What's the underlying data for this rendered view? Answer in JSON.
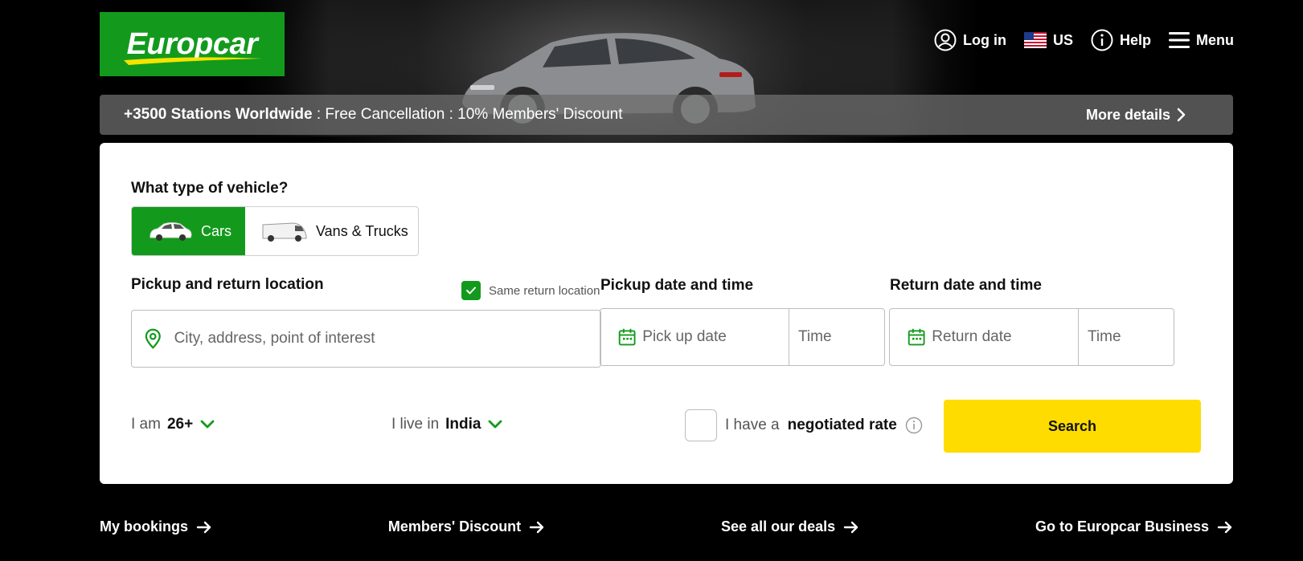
{
  "brand": {
    "name": "Europcar",
    "color": "#139a1d"
  },
  "nav": {
    "login": "Log in",
    "country": "US",
    "help": "Help",
    "menu": "Menu"
  },
  "promo": {
    "strong": "+3500 Stations Worldwide",
    "rest": " : Free Cancellation : 10% Members' Discount",
    "more": "More details"
  },
  "booking": {
    "vehicle_question": "What type of vehicle?",
    "vehicle_types": [
      {
        "label": "Cars",
        "selected": true
      },
      {
        "label": "Vans & Trucks",
        "selected": false
      }
    ],
    "location_label": "Pickup and return location",
    "same_return_label": "Same return location",
    "same_return_checked": true,
    "location_placeholder": "City, address, point of interest",
    "pickup_label": "Pickup date and time",
    "pickup_date_placeholder": "Pick up date",
    "pickup_time_placeholder": "Time",
    "return_label": "Return date and time",
    "return_date_placeholder": "Return date",
    "return_time_placeholder": "Time",
    "age_prefix": "I am",
    "age_value": "26+",
    "country_prefix": "I live in",
    "country_value": "India",
    "negotiated_prefix": "I have a",
    "negotiated_strong": "negotiated rate",
    "search_label": "Search",
    "accent_yellow": "#ffdc00"
  },
  "footer_links": [
    "My bookings",
    "Members' Discount",
    "See all our deals",
    "Go to Europcar Business"
  ]
}
